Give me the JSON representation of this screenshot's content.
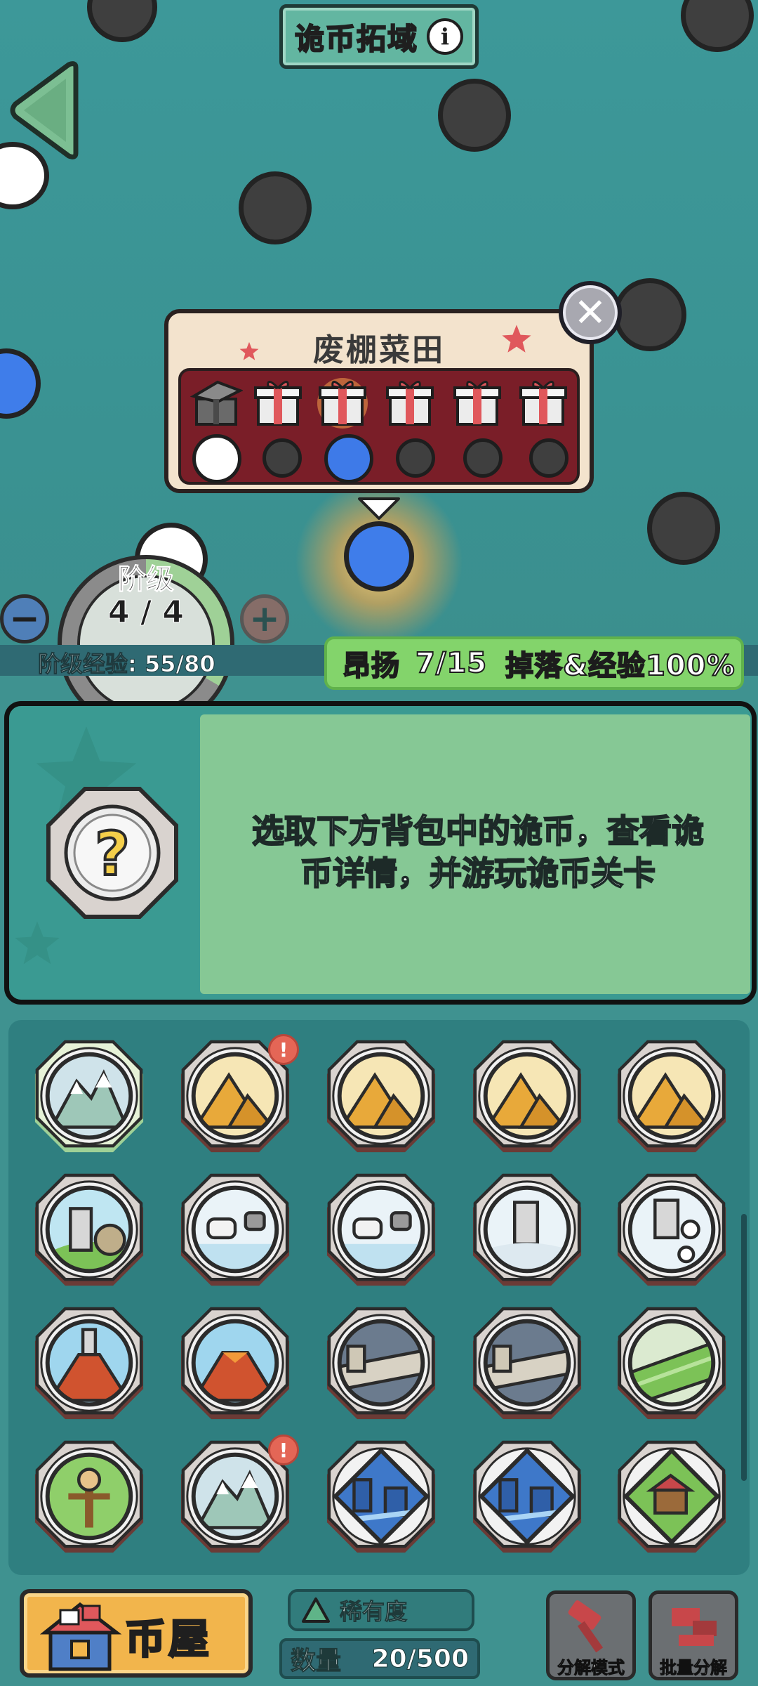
{
  "header": {
    "title": "诡币拓域",
    "info_icon": "info-icon"
  },
  "popup": {
    "title": "废棚菜田",
    "gifts": [
      "opened-gift",
      "gift",
      "gift-highlighted",
      "gift",
      "gift",
      "gift"
    ],
    "slots": [
      "white",
      "dark",
      "blue",
      "dark",
      "dark",
      "dark"
    ],
    "close_icon": "close-icon"
  },
  "stage": {
    "label": "阶级",
    "value": "4 / 4",
    "exp_text": "阶级经验: 55/80",
    "minus": "−",
    "plus": "+"
  },
  "status": {
    "mood": "昂扬",
    "mood_value": "7/15",
    "bonus": "掉落&经验100%"
  },
  "detail": {
    "text_line1": "选取下方背包中的诡币，查看诡",
    "text_line2": "币详情，并游玩诡币关卡"
  },
  "coins": [
    {
      "theme": "snow-mountain",
      "selected": true,
      "alert": false
    },
    {
      "theme": "pyramid",
      "selected": false,
      "alert": true
    },
    {
      "theme": "pyramid",
      "selected": false,
      "alert": false
    },
    {
      "theme": "pyramid",
      "selected": false,
      "alert": false
    },
    {
      "theme": "pyramid",
      "selected": false,
      "alert": false
    },
    {
      "theme": "grass-tower",
      "selected": false,
      "alert": false
    },
    {
      "theme": "snowfield",
      "selected": false,
      "alert": false
    },
    {
      "theme": "snowfield",
      "selected": false,
      "alert": false
    },
    {
      "theme": "snow-tower",
      "selected": false,
      "alert": false
    },
    {
      "theme": "snow-skull-tower",
      "selected": false,
      "alert": false
    },
    {
      "theme": "volcano-tower",
      "selected": false,
      "alert": false
    },
    {
      "theme": "volcano",
      "selected": false,
      "alert": false
    },
    {
      "theme": "great-wall",
      "selected": false,
      "alert": false
    },
    {
      "theme": "great-wall",
      "selected": false,
      "alert": false
    },
    {
      "theme": "green-field",
      "selected": false,
      "alert": false
    },
    {
      "theme": "scarecrow",
      "selected": false,
      "alert": false
    },
    {
      "theme": "snow-mountain",
      "selected": false,
      "alert": true
    },
    {
      "theme": "blue-ruins",
      "selected": false,
      "alert": false
    },
    {
      "theme": "blue-ruins",
      "selected": false,
      "alert": false
    },
    {
      "theme": "green-cabin",
      "selected": false,
      "alert": false
    }
  ],
  "alert_mark": "!",
  "bottom": {
    "house_label": "币屋",
    "rarity_label": "稀有度",
    "count_label": "数量",
    "count_value": "20/500",
    "decompose_mode": "分解模式",
    "batch_decompose": "批量分解"
  },
  "colors": {
    "bg": "#3f9290",
    "node_blue": "#3f7dea",
    "status_green": "#83d46b",
    "popup_red": "#7a1e28",
    "house_orange": "#f2b54c"
  }
}
